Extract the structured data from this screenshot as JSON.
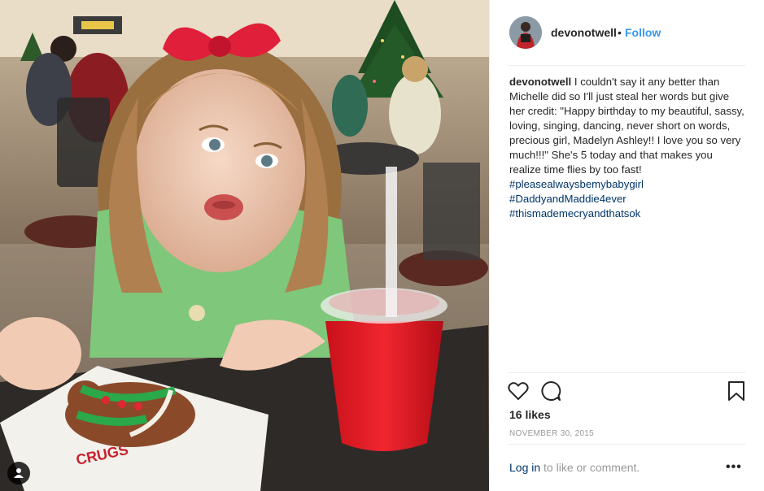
{
  "post": {
    "username": "devonotwell",
    "separator": "•",
    "follow_label": "Follow",
    "caption": {
      "username": "devonotwell",
      "text": "I couldn't say it any better than Michelle did so I'll just steal her words but give her credit: \"Happy birthday to my beautiful, sassy, loving, singing, dancing, never short on words, precious girl, Madelyn Ashley!! I love you so very much!!!\" She's 5 today and that makes you realize time flies by too fast!",
      "hashtags": [
        "#pleasealwaysbemybabygirl",
        "#DaddyandMaddie4ever",
        "#thismademecryandthatsok"
      ]
    },
    "likes": "16 likes",
    "date": "NOVEMBER 30, 2015",
    "login_link": "Log in",
    "login_suffix": " to like or comment.",
    "more_label": "•••"
  },
  "photo": {
    "cup_logo_text": "CRUGS"
  },
  "icons": {
    "like": "heart-icon",
    "comment": "comment-icon",
    "save": "bookmark-icon",
    "tag": "user-tag-icon"
  },
  "colors": {
    "link": "#3897f0",
    "hashtag": "#003569",
    "text": "#262626",
    "muted": "#999999"
  }
}
